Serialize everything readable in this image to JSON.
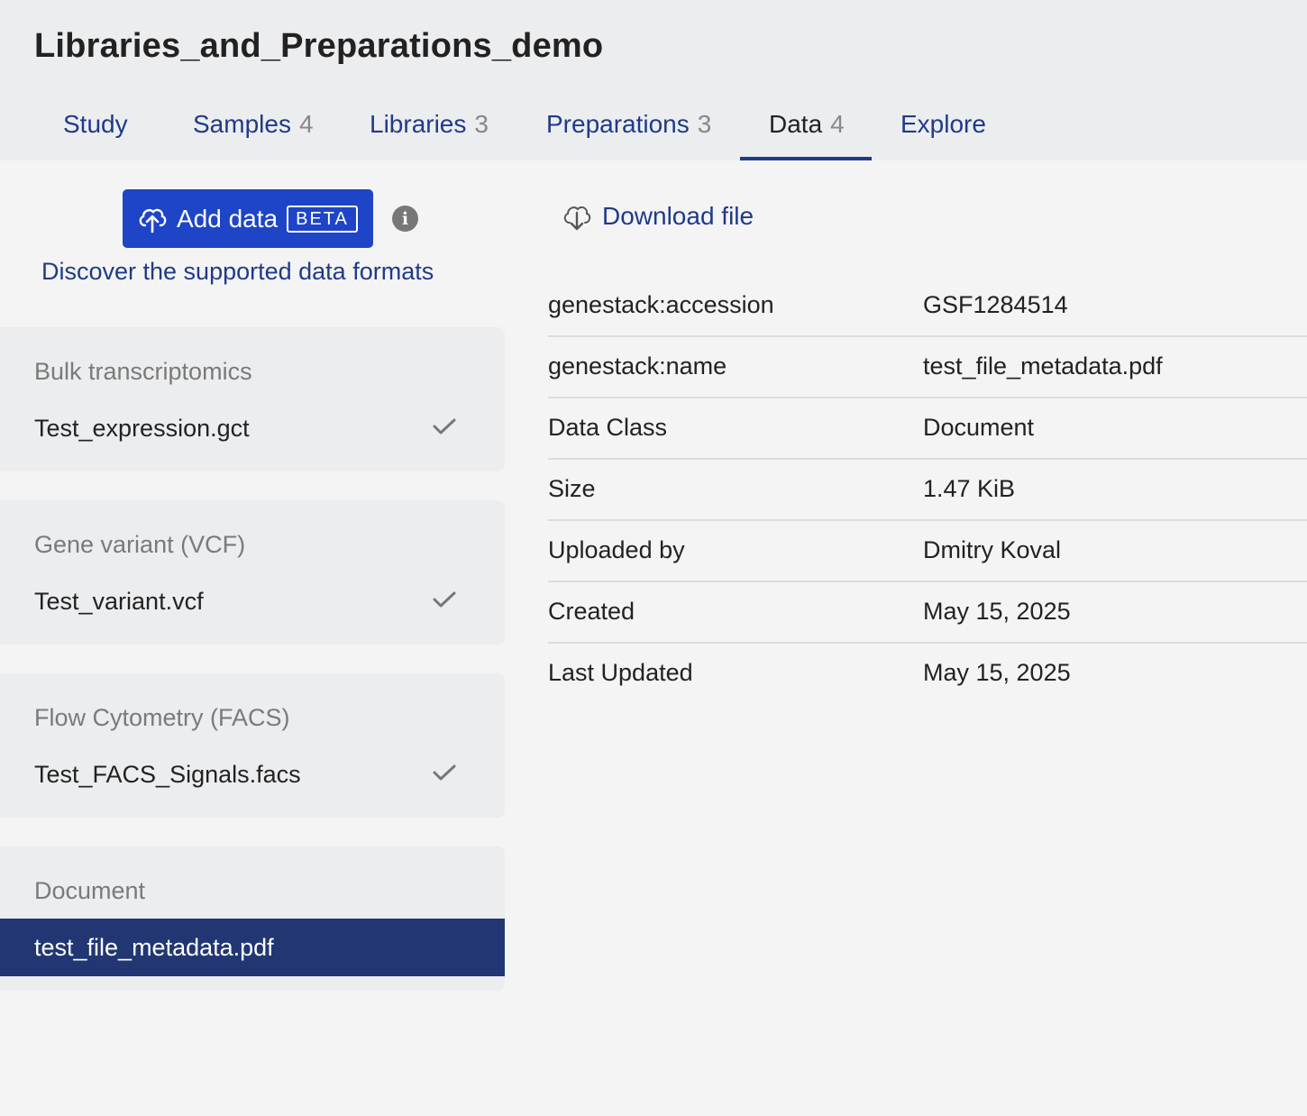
{
  "page": {
    "title": "Libraries_and_Preparations_demo"
  },
  "tabs": [
    {
      "label": "Study",
      "count": ""
    },
    {
      "label": "Samples",
      "count": "4"
    },
    {
      "label": "Libraries",
      "count": "3"
    },
    {
      "label": "Preparations",
      "count": "3"
    },
    {
      "label": "Data",
      "count": "4",
      "active": true
    },
    {
      "label": "Explore",
      "count": ""
    }
  ],
  "sidebar": {
    "add_button": {
      "label": "Add data",
      "badge": "BETA",
      "icon": "cloud-upload-icon"
    },
    "info_icon": "info-icon",
    "formats_link": "Discover the supported data formats",
    "groups": [
      {
        "title": "Bulk transcriptomics",
        "files": [
          {
            "name": "Test_expression.gct",
            "checked": true
          }
        ]
      },
      {
        "title": "Gene variant (VCF)",
        "files": [
          {
            "name": "Test_variant.vcf",
            "checked": true
          }
        ]
      },
      {
        "title": "Flow Cytometry (FACS)",
        "files": [
          {
            "name": "Test_FACS_Signals.facs",
            "checked": true
          }
        ]
      },
      {
        "title": "Document",
        "files": [
          {
            "name": "test_file_metadata.pdf",
            "selected": true
          }
        ]
      }
    ]
  },
  "detail": {
    "download_label": "Download file",
    "download_icon": "cloud-download-icon",
    "metadata": [
      {
        "key": "genestack:accession",
        "value": "GSF1284514"
      },
      {
        "key": "genestack:name",
        "value": "test_file_metadata.pdf"
      },
      {
        "key": "Data Class",
        "value": "Document"
      },
      {
        "key": "Size",
        "value": "1.47 KiB"
      },
      {
        "key": "Uploaded by",
        "value": "Dmitry Koval"
      },
      {
        "key": "Created",
        "value": "May 15, 2025"
      },
      {
        "key": "Last Updated",
        "value": "May 15, 2025"
      }
    ]
  },
  "colors": {
    "accent": "#1f3a8a",
    "button": "#1e45c7",
    "selected_row": "#213673"
  }
}
